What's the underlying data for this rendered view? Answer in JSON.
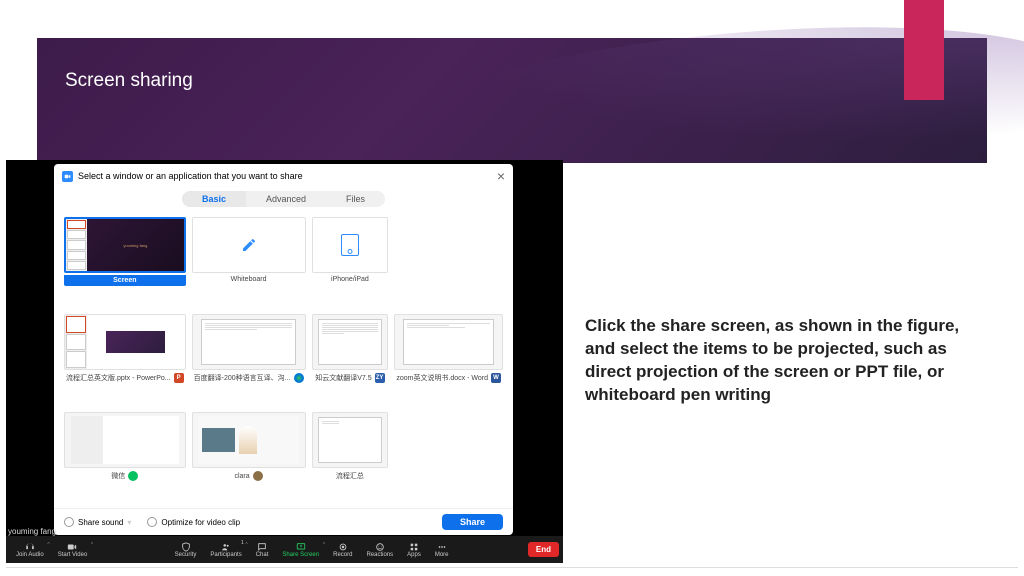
{
  "slide": {
    "title": "Screen sharing",
    "instruction": "Click the share screen, as shown in the figure, and select the items to be projected, such as direct projection of the screen or PPT file, or whiteboard pen writing"
  },
  "dialog": {
    "title": "Select a window or an application that you want to share",
    "tabs": {
      "basic": "Basic",
      "advanced": "Advanced",
      "files": "Files"
    },
    "items": [
      {
        "label": "Screen",
        "type": "screen"
      },
      {
        "label": "Whiteboard",
        "type": "whiteboard"
      },
      {
        "label": "iPhone/iPad",
        "type": "ipad"
      },
      {
        "label": "",
        "type": "empty"
      },
      {
        "label": "流程汇总英文版.pptx - PowerPo...",
        "type": "app",
        "badge": "ppt"
      },
      {
        "label": "百度翻译-200种语言互译、沟...",
        "type": "app",
        "badge": "edge"
      },
      {
        "label": "知云文献翻译V7.5",
        "type": "app",
        "badge": "zy"
      },
      {
        "label": "zoom英文说明书.docx - Word",
        "type": "app",
        "badge": "word"
      },
      {
        "label": "微信",
        "type": "app",
        "badge": "wechat"
      },
      {
        "label": "clara",
        "type": "app",
        "badge": "avatar"
      },
      {
        "label": "流程汇总",
        "type": "app",
        "badge": ""
      }
    ],
    "share_sound": "Share sound",
    "optimize": "Optimize for video clip",
    "share_button": "Share"
  },
  "user_name": "youming fang",
  "toolbar": {
    "join_audio": "Join Audio",
    "start_video": "Start Video",
    "security": "Security",
    "participants": "Participants",
    "participants_count": "1",
    "chat": "Chat",
    "share_screen": "Share Screen",
    "record": "Record",
    "reactions": "Reactions",
    "apps": "Apps",
    "more": "More",
    "end": "End"
  },
  "screen_label": "youming fang"
}
